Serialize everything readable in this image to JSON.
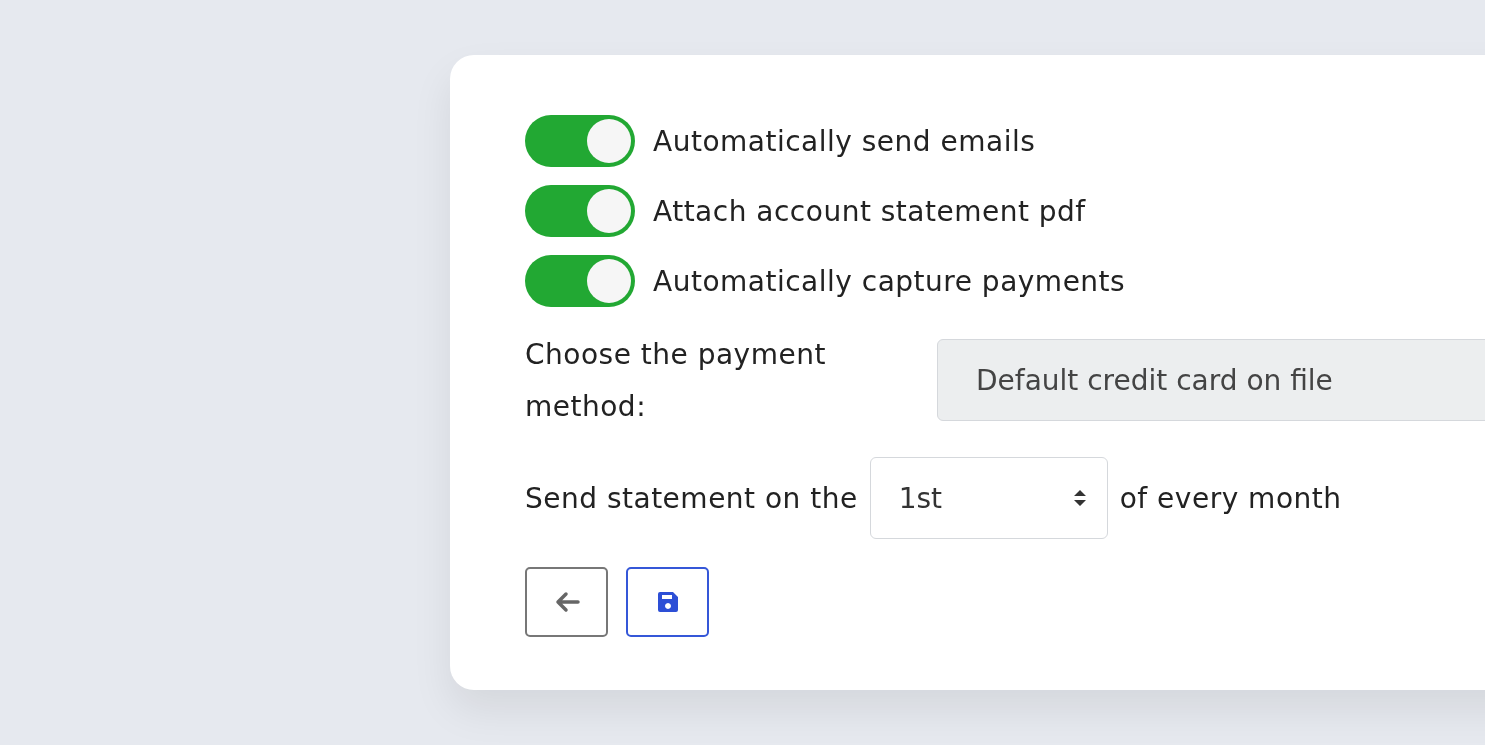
{
  "toggles": [
    {
      "label": "Automatically send emails",
      "on": true
    },
    {
      "label": "Attach account statement pdf",
      "on": true
    },
    {
      "label": "Automatically capture payments",
      "on": true
    }
  ],
  "payment_method": {
    "label": "Choose the payment method:",
    "value": "Default credit card on file"
  },
  "schedule": {
    "prefix": "Send statement on the",
    "value": "1st",
    "suffix": "of every month"
  },
  "buttons": [
    {
      "kind": "back"
    },
    {
      "kind": "save"
    }
  ]
}
